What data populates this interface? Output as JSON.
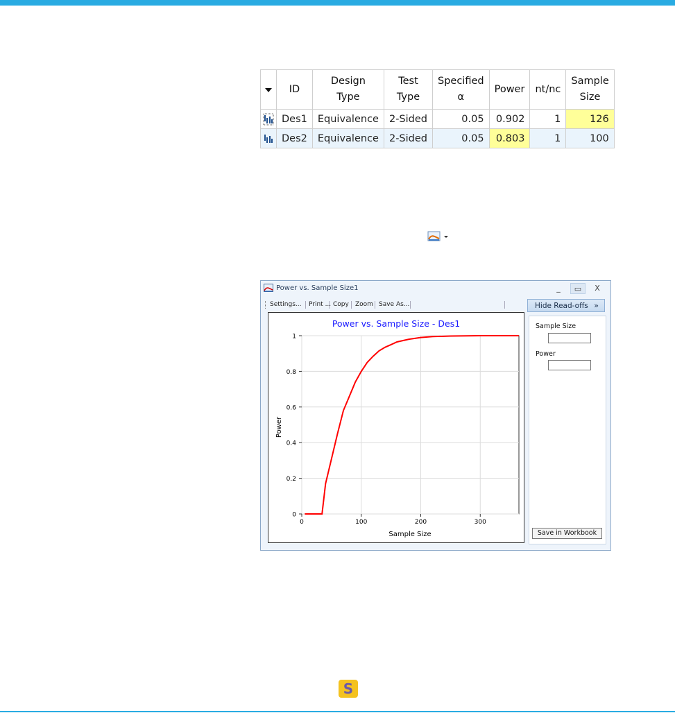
{
  "table": {
    "headers": [
      "ID",
      "Design\nType",
      "Test\nType",
      "Specified\nα",
      "Power",
      "nt/nc",
      "Sample\nSize"
    ],
    "rows": [
      {
        "id": "Des1",
        "design_type": "Equivalence",
        "test_type": "2-Sided",
        "alpha": "0.05",
        "power": "0.902",
        "ntnc": "1",
        "sample_size": "126"
      },
      {
        "id": "Des2",
        "design_type": "Equivalence",
        "test_type": "2-Sided",
        "alpha": "0.05",
        "power": "0.803",
        "ntnc": "1",
        "sample_size": "100"
      }
    ]
  },
  "window": {
    "title": "Power vs. Sample Size1",
    "minimize": "_",
    "maximize": "▭",
    "close": "X",
    "toolbar": [
      "Settings...",
      "Print ...",
      "Copy",
      "Zoom",
      "Save As..."
    ],
    "readoff_button": "Hide Read-offs",
    "readoff_chevron": "»",
    "readoff": {
      "sample_size_label": "Sample Size",
      "sample_size_value": "",
      "power_label": "Power",
      "power_value": "",
      "save_button": "Save in Workbook"
    }
  },
  "chart_data": {
    "type": "line",
    "title": "Power vs. Sample Size - Des1",
    "xlabel": "Sample Size",
    "ylabel": "Power",
    "xlim": [
      0,
      365
    ],
    "ylim": [
      0,
      1
    ],
    "xticks": [
      0,
      100,
      200,
      300
    ],
    "yticks": [
      0,
      0.2,
      0.4,
      0.6,
      0.8,
      1
    ],
    "ytick_labels": [
      "0",
      "0.2",
      "0.4",
      "0.6",
      "0.8",
      "1"
    ],
    "grid": true,
    "series": [
      {
        "color": "#ff0000",
        "x": [
          5,
          34,
          40,
          50,
          60,
          70,
          80,
          90,
          100,
          110,
          120,
          130,
          140,
          150,
          160,
          180,
          200,
          220,
          250,
          300,
          365
        ],
        "y": [
          0,
          0,
          0.17,
          0.31,
          0.45,
          0.58,
          0.66,
          0.74,
          0.8,
          0.85,
          0.885,
          0.915,
          0.935,
          0.95,
          0.965,
          0.98,
          0.99,
          0.995,
          0.998,
          1.0,
          1.0
        ]
      }
    ]
  },
  "badge": {
    "letter": "S"
  },
  "colors": {
    "accent": "#29abe2",
    "highlight": "#ffff99",
    "series": "#ff0000",
    "title_text": "#1a1aff"
  }
}
